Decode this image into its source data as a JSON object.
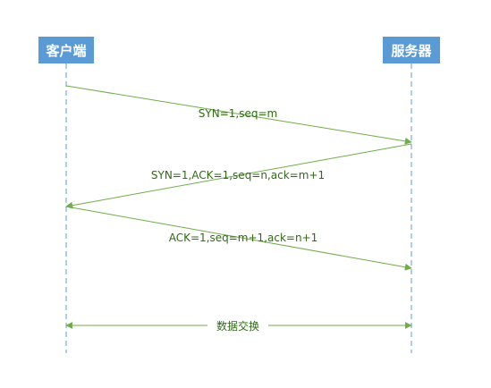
{
  "actors": {
    "client": "客户端",
    "server": "服务器"
  },
  "messages": [
    {
      "label": "SYN=1,seq=m",
      "from": "client",
      "to": "server"
    },
    {
      "label": "SYN=1,ACK=1,seq=n,ack=m+1",
      "from": "server",
      "to": "client"
    },
    {
      "label": "ACK=1,seq=m+1,ack=n+1",
      "from": "client",
      "to": "server"
    }
  ],
  "exchange": {
    "label": "数据交换",
    "direction": "bidirectional"
  },
  "colors": {
    "actor_fill": "#5b9bd5",
    "lifeline": "#5b9bd5",
    "arrow": "#70ad47",
    "label": "#2e6b12"
  }
}
